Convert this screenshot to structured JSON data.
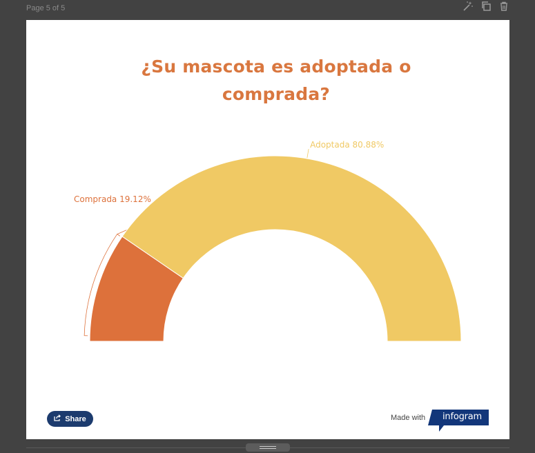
{
  "editor": {
    "page_label": "Page 5 of 5",
    "toolbar_icons": [
      "magic-wand-icon",
      "duplicate-icon",
      "trash-icon"
    ]
  },
  "colors": {
    "title": "#d9773f",
    "adoptada": "#f0c964",
    "comprada": "#dd713b",
    "share_bg": "#1c3b6e",
    "infogram_bg": "#12367a"
  },
  "chart_data": {
    "type": "pie",
    "variant": "semi-donut",
    "title_lines": [
      "¿Su mascota es adoptada o",
      "comprada?"
    ],
    "slices": [
      {
        "label": "Comprada",
        "value": 19.12,
        "display": "Comprada 19.12%",
        "color": "#dd713b"
      },
      {
        "label": "Adoptada",
        "value": 80.88,
        "display": "Adoptada 80.88%",
        "color": "#f0c964"
      }
    ]
  },
  "footer": {
    "share_label": "Share",
    "made_with": "Made with",
    "brand": "infogram"
  }
}
